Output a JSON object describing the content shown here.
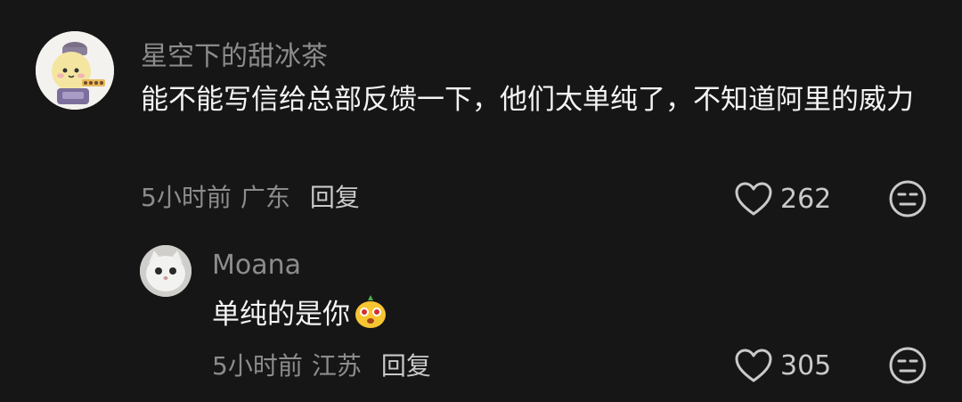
{
  "comments": [
    {
      "username": "星空下的甜冰茶",
      "text": "能不能写信给总部反馈一下，他们太单纯了，不知道阿里的威力",
      "time": "5小时前",
      "location": "广东",
      "reply_label": "回复",
      "likes": "262",
      "avatar_icon": "cartoon-egg-chef-avatar",
      "like_icon": "heart-outline-icon",
      "dislike_icon": "neutral-face-icon"
    },
    {
      "username": "Moana",
      "text": "单纯的是你",
      "emoji": "yellow-mischief-face-emoji",
      "time": "5小时前",
      "location": "江苏",
      "reply_label": "回复",
      "likes": "305",
      "avatar_icon": "white-cat-avatar",
      "like_icon": "heart-outline-icon",
      "dislike_icon": "neutral-face-icon"
    }
  ],
  "colors": {
    "background": "#161616",
    "username": "#8c8c8c",
    "text": "#f4f4f4",
    "meta": "#8c8c8c",
    "action": "#c9c9c9"
  }
}
